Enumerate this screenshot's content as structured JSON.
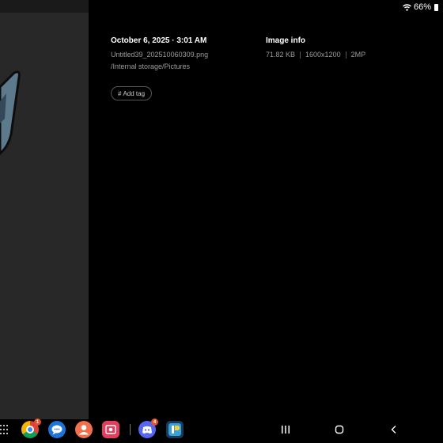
{
  "status_bar": {
    "battery_text": "66%"
  },
  "details": {
    "date_time": "October 6, 2025 · 3:01 AM",
    "file_name": "Untitled39_202510060309.png",
    "file_path": "/Internal storage/Pictures",
    "add_tag_label": "Add tag"
  },
  "image_info": {
    "title": "Image info",
    "size": "71.82 KB",
    "resolution": "1600x1200",
    "megapixels": "2MP"
  },
  "taskbar": {
    "apps": [
      {
        "name": "chrome-app-icon",
        "badge": "1"
      },
      {
        "name": "messages-app-icon"
      },
      {
        "name": "contacts-app-icon"
      },
      {
        "name": "screen-recorder-app-icon"
      },
      {
        "name": "discord-app-icon",
        "badge": "4"
      },
      {
        "name": "ibis-paint-app-icon"
      }
    ]
  }
}
